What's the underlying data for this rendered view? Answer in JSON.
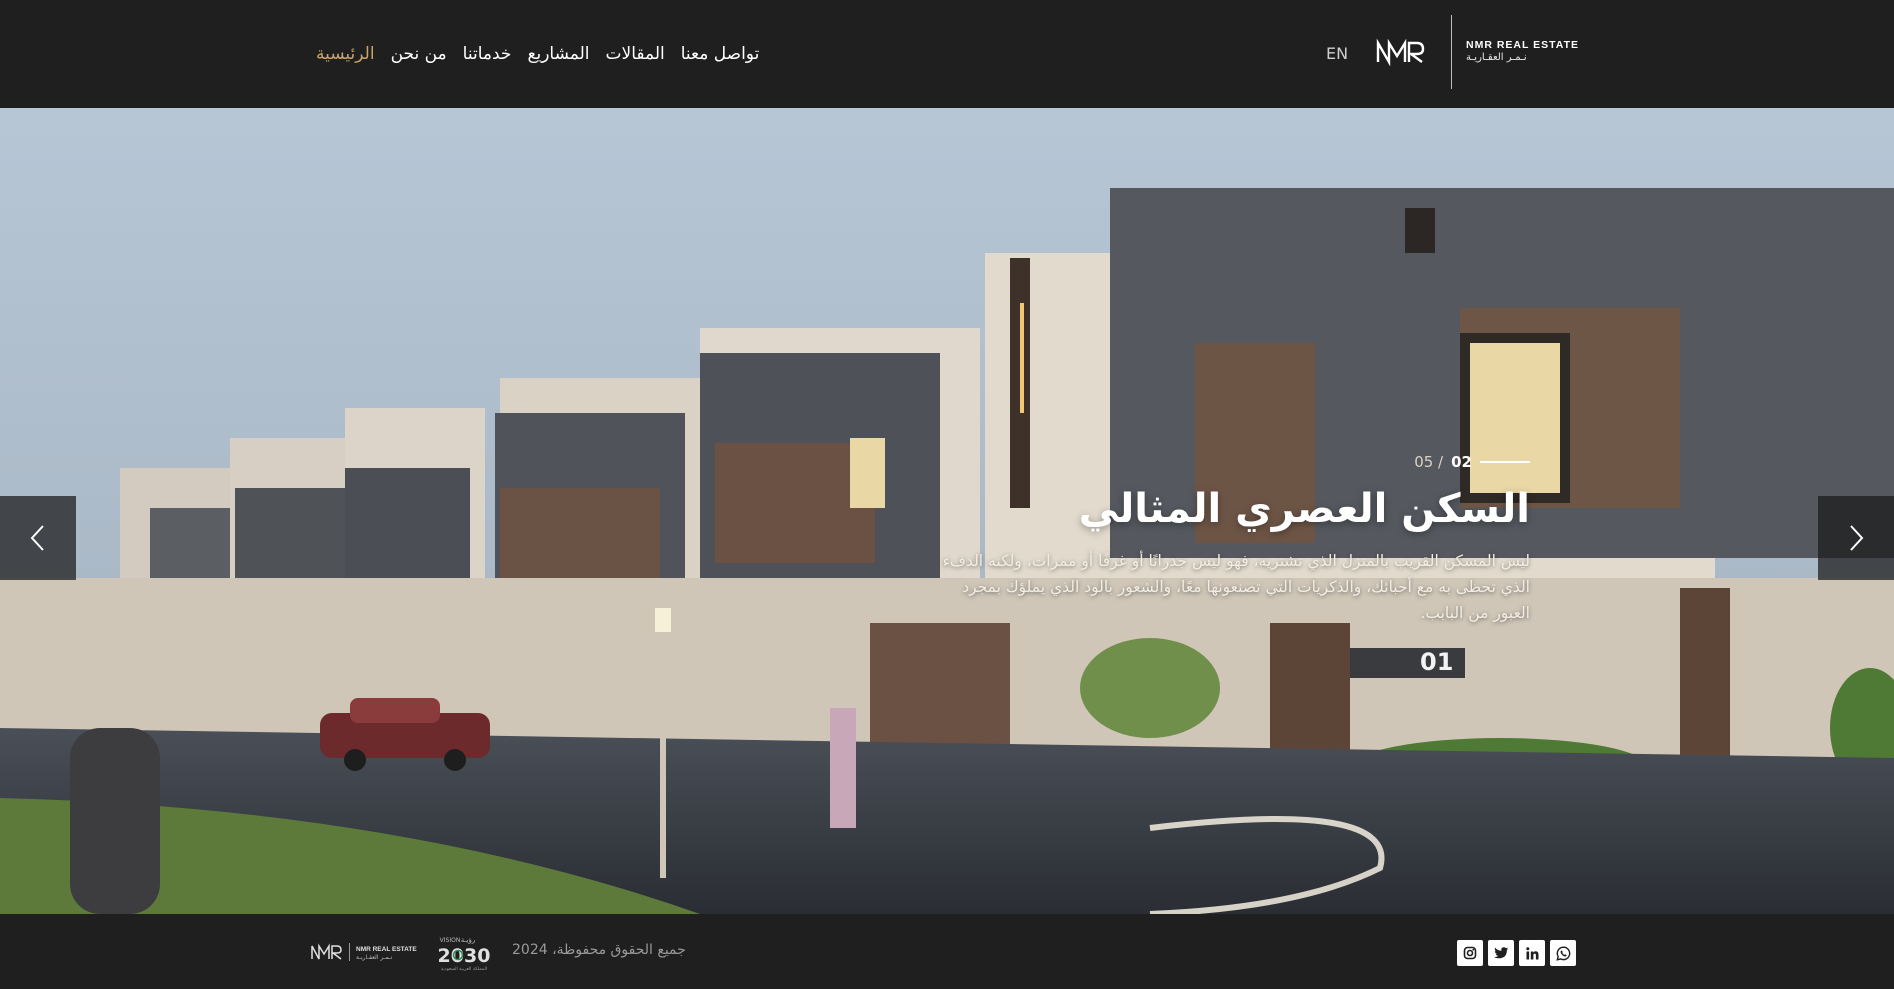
{
  "header": {
    "nav": [
      {
        "label": "الرئيسية",
        "active": true
      },
      {
        "label": "من نحن",
        "active": false
      },
      {
        "label": "خدماتنا",
        "active": false
      },
      {
        "label": "المشاريع",
        "active": false
      },
      {
        "label": "المقالات",
        "active": false
      },
      {
        "label": "تواصل معنا",
        "active": false
      }
    ],
    "lang_label": "EN",
    "logo_mark": "NMR",
    "brand_en": "NMR REAL ESTATE",
    "brand_ar": "نـمـر العقـاريـة"
  },
  "hero": {
    "current_slide": "02",
    "total_slides": "05 /",
    "title": "السكن العصري المثالي",
    "description": "ليس المسكن القريب بالمنزل الذي تشتريه، فهو ليس جدرانًا أو غرفًا أو ممرات، ولكنه الدفء الذي تحظى به مع أحبائك، والذكريات التي تصنعونها معًا، والشعور بالود الذي يملؤك بمجرد العبور من البابب.",
    "house_number": "01",
    "prev_icon": "chevron-left-icon",
    "next_icon": "chevron-right-icon"
  },
  "footer": {
    "copyright": "جميع الحقوق محفوظة، 2024",
    "vision_label": "VISION",
    "vision_ar": "رؤيـة",
    "vision_year": "2030",
    "vision_sub": "المملكة العربية السعودية",
    "social": [
      "whatsapp-icon",
      "linkedin-icon",
      "twitter-icon",
      "instagram-icon"
    ]
  },
  "colors": {
    "background": "#1f1f1f",
    "accent": "#c9a467",
    "text": "#ffffff"
  }
}
